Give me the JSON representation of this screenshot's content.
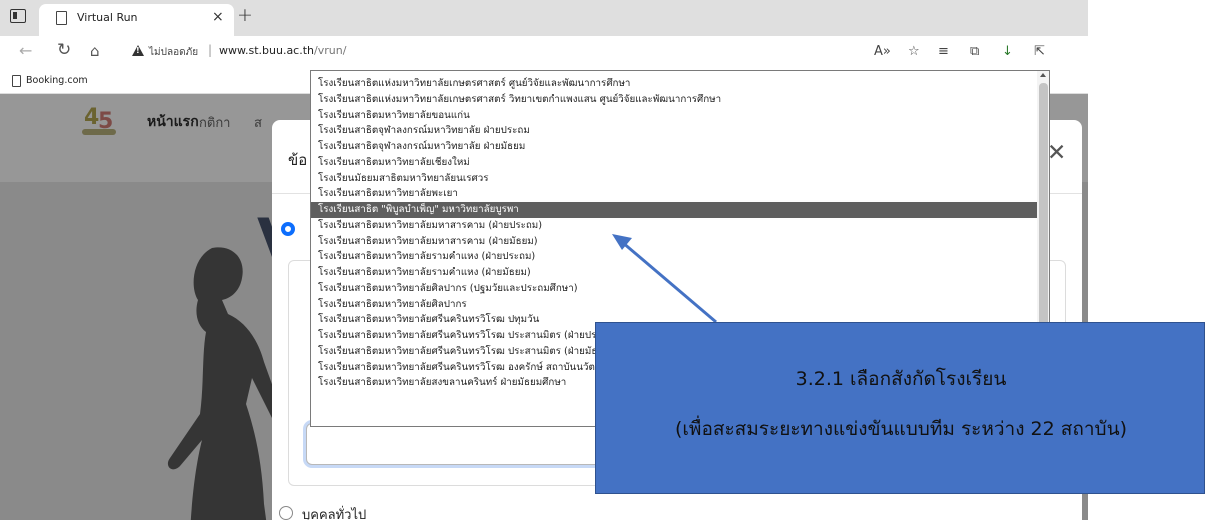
{
  "browser": {
    "tab_title": "Virtual Run",
    "tab_close": "×",
    "new_tab": "+",
    "security_text": "ไม่ปลอดภัย",
    "url_separator": "|",
    "url_host": "www.st.buu.ac.th",
    "url_path": "/vrun/",
    "favorites": [
      {
        "label": "Booking.com"
      }
    ],
    "icons": [
      "back-icon",
      "refresh-icon",
      "home-icon",
      "warning-icon",
      "read-aloud-icon",
      "favorite-icon",
      "favorites-list-icon",
      "collections-icon",
      "download-icon",
      "share-icon"
    ]
  },
  "page": {
    "nav": {
      "home": "หน้าแรก",
      "rules": "กติกา",
      "partial": "ส"
    },
    "hero_letter": "V"
  },
  "modal": {
    "title_partial": "ข้อ",
    "close": "✕",
    "option_general": "บุคคลทั่วไป",
    "accent_color": "#0d6efd"
  },
  "dropdown": {
    "selected_index": 8,
    "items": [
      "โรงเรียนสาธิตแห่งมหาวิทยาลัยเกษตรศาสตร์ ศูนย์วิจัยและพัฒนาการศึกษา",
      "โรงเรียนสาธิตแห่งมหาวิทยาลัยเกษตรศาสตร์ วิทยาเขตกำแพงแสน ศูนย์วิจัยและพัฒนาการศึกษา",
      "โรงเรียนสาธิตมหาวิทยาลัยขอนแก่น",
      "โรงเรียนสาธิตจุฬาลงกรณ์มหาวิทยาลัย ฝ่ายประถม",
      "โรงเรียนสาธิตจุฬาลงกรณ์มหาวิทยาลัย ฝ่ายมัธยม",
      "โรงเรียนสาธิตมหาวิทยาลัยเชียงใหม่",
      "โรงเรียนมัธยมสาธิตมหาวิทยาลัยนเรศวร",
      "โรงเรียนสาธิตมหาวิทยาลัยพะเยา",
      "โรงเรียนสาธิต \"พิบูลบำเพ็ญ\" มหาวิทยาลัยบูรพา",
      "โรงเรียนสาธิตมหาวิทยาลัยมหาสารคาม (ฝ่ายประถม)",
      "โรงเรียนสาธิตมหาวิทยาลัยมหาสารคาม (ฝ่ายมัธยม)",
      "โรงเรียนสาธิตมหาวิทยาลัยรามคำแหง (ฝ่ายประถม)",
      "โรงเรียนสาธิตมหาวิทยาลัยรามคำแหง (ฝ่ายมัธยม)",
      "โรงเรียนสาธิตมหาวิทยาลัยศิลปากร (ปฐมวัยและประถมศึกษา)",
      "โรงเรียนสาธิตมหาวิทยาลัยศิลปากร",
      "โรงเรียนสาธิตมหาวิทยาลัยศรีนครินทรวิโรฒ ปทุมวัน",
      "โรงเรียนสาธิตมหาวิทยาลัยศรีนครินทรวิโรฒ ประสานมิตร (ฝ่ายประถม)",
      "โรงเรียนสาธิตมหาวิทยาลัยศรีนครินทรวิโรฒ ประสานมิตร (ฝ่ายมัธยม)",
      "โรงเรียนสาธิตมหาวิทยาลัยศรีนครินทรวิโรฒ องครักษ์ สถาบันนวัตกรรมการเรียนรู้",
      "โรงเรียนสาธิตมหาวิทยาลัยสงขลานครินทร์ ฝ่ายมัธยมศึกษา"
    ]
  },
  "annotation": {
    "line1": "3.2.1 เลือกสังกัดโรงเรียน",
    "line2": "(เพื่อสะสมระยะทางแข่งขันแบบทีม ระหว่าง 22 สถาบัน)",
    "box_color": "#4472c4",
    "arrow_color": "#4472c4"
  }
}
